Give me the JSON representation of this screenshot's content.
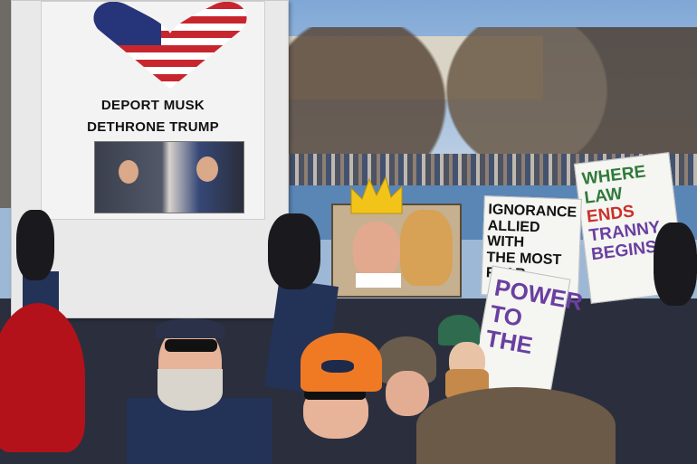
{
  "scene": {
    "left_poster": {
      "line1": "DEPORT MUSK",
      "line2": "DETHRONE TRUMP"
    },
    "sign_law": {
      "lines": [
        "WHERE LAW",
        "ENDS",
        "TRANNY",
        "BEGINS"
      ]
    },
    "sign_ignorance": {
      "lines": [
        "IGNORANCE",
        "ALLIED WITH",
        "THE MOST FEAR-"
      ]
    },
    "sign_power": {
      "lines": [
        "POWER",
        "TO THE"
      ]
    },
    "colors": {
      "sign_red": "#c9322a",
      "sign_green": "#2f7a3a",
      "sign_purple": "#6a3fa0",
      "beanie_orange": "#f07a24",
      "hat_red": "#b3121b"
    }
  }
}
